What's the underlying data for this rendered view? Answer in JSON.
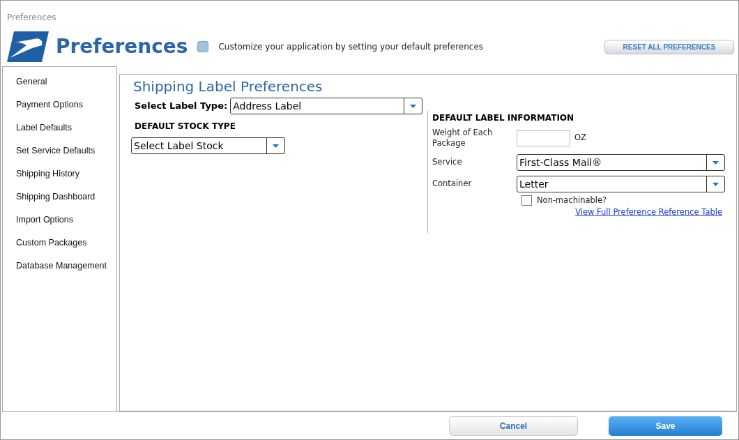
{
  "window": {
    "title": "Preferences"
  },
  "header": {
    "title": "Preferences",
    "description": "Customize your application by setting your default preferences",
    "reset_button": "RESET ALL PREFERENCES"
  },
  "sidebar": {
    "items": [
      {
        "label": "General"
      },
      {
        "label": "Payment Options"
      },
      {
        "label": "Label Defaults"
      },
      {
        "label": "Set Service Defaults"
      },
      {
        "label": "Shipping History"
      },
      {
        "label": "Shipping Dashboard"
      },
      {
        "label": "Import Options"
      },
      {
        "label": "Custom Packages"
      },
      {
        "label": "Database Management"
      }
    ]
  },
  "main": {
    "title": "Shipping Label Preferences",
    "label_type": {
      "label": "Select Label Type:",
      "value": "Address Label"
    },
    "stock": {
      "heading": "DEFAULT STOCK TYPE",
      "value": "Select Label Stock"
    },
    "label_info": {
      "heading": "DEFAULT LABEL INFORMATION",
      "weight_label": "Weight of Each Package",
      "weight_unit": "OZ",
      "service_label": "Service",
      "service_value": "First-Class Mail®",
      "container_label": "Container",
      "container_value": "Letter",
      "non_machinable": {
        "label": "Non-machinable?",
        "checked": false
      },
      "link": "View Full Preference Reference Table"
    }
  },
  "footer": {
    "cancel": "Cancel",
    "save": "Save"
  }
}
